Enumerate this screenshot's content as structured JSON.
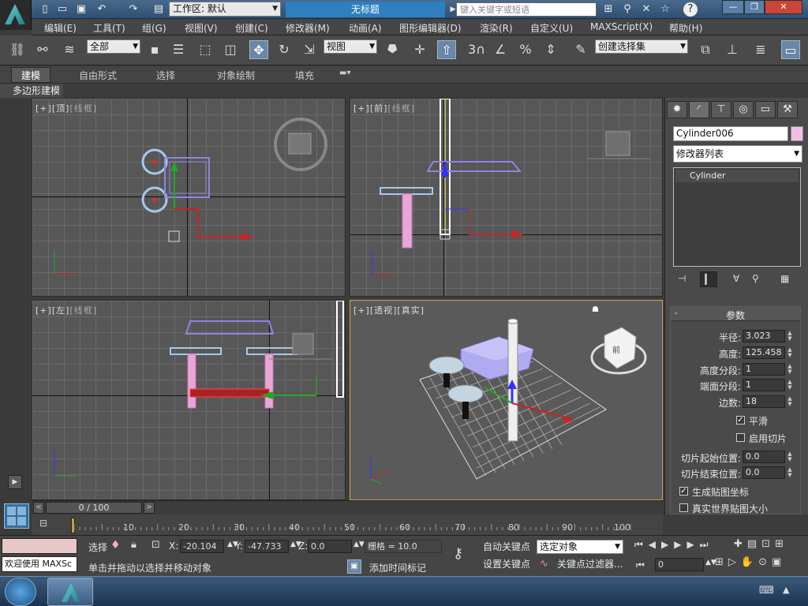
{
  "titlebar": {
    "workspace_label": "工作区: 默认",
    "doc_title": "无标题",
    "search_placeholder": "键入关键字或短语"
  },
  "menu": [
    "编辑(E)",
    "工具(T)",
    "组(G)",
    "视图(V)",
    "创建(C)",
    "修改器(M)",
    "动画(A)",
    "图形编辑器(D)",
    "渲染(R)",
    "自定义(U)",
    "MAXScript(X)",
    "帮助(H)"
  ],
  "toolbar": {
    "selection_filter": "全部",
    "ref_coord": "视图",
    "snap_3": "3",
    "named_selection": "创建选择集"
  },
  "ribbon": {
    "tabs": [
      "建模",
      "自由形式",
      "选择",
      "对象绘制",
      "填充"
    ],
    "active_tab": "建模",
    "sub_label": "多边形建模"
  },
  "viewports": {
    "top": {
      "label": [
        "[+]",
        "[顶]",
        "[线框]"
      ]
    },
    "front": {
      "label": [
        "[+]",
        "[前]",
        "[线框]"
      ]
    },
    "left": {
      "label": [
        "[+]",
        "[左]",
        "[线框]"
      ]
    },
    "persp": {
      "label": [
        "[+]",
        "[透视]",
        "[真实]"
      ]
    }
  },
  "command_panel": {
    "object_name": "Cylinder006",
    "modifier_list": "修改器列表",
    "stack_item": "Cylinder",
    "rollout_title": "参数",
    "params": [
      {
        "label": "半径:",
        "value": "3.023"
      },
      {
        "label": "高度:",
        "value": "125.458"
      },
      {
        "label": "高度分段:",
        "value": "1"
      },
      {
        "label": "端面分段:",
        "value": "1"
      },
      {
        "label": "边数:",
        "value": "18"
      }
    ],
    "smooth": {
      "label": "平滑",
      "checked": true
    },
    "slice_on": {
      "label": "启用切片",
      "checked": false
    },
    "slice_from": {
      "label": "切片起始位置:",
      "value": "0.0"
    },
    "slice_to": {
      "label": "切片结束位置:",
      "value": "0.0"
    },
    "gen_mapping": {
      "label": "生成贴图坐标",
      "checked": true
    },
    "real_world": {
      "label": "真实世界贴图大小",
      "checked": false
    }
  },
  "timeline": {
    "frame_display": "0 / 100",
    "ticks": [
      "10",
      "20",
      "30",
      "40",
      "50",
      "60",
      "70",
      "80",
      "90",
      "100"
    ]
  },
  "status": {
    "welcome": "欢迎使用 MAXSc",
    "select_label": "选择",
    "x_label": "X:",
    "x_value": "-20.104",
    "y_label": "Y:",
    "y_value": "-47.733",
    "z_label": "Z:",
    "z_value": "0.0",
    "grid": "栅格 = 10.0",
    "prompt": "单击并拖动以选择并移动对象",
    "add_time_tag": "添加时间标记",
    "auto_key": "自动关键点",
    "set_key": "设置关键点",
    "key_mode": "选定对象",
    "key_filters": "关键点过滤器...",
    "frame_value": "0"
  },
  "colors": {
    "accent_blue": "#2d7fbf",
    "persp_border": "#d3a34a",
    "object_pink": "#e8a5d8",
    "object_lavender": "#a4a0e8"
  }
}
